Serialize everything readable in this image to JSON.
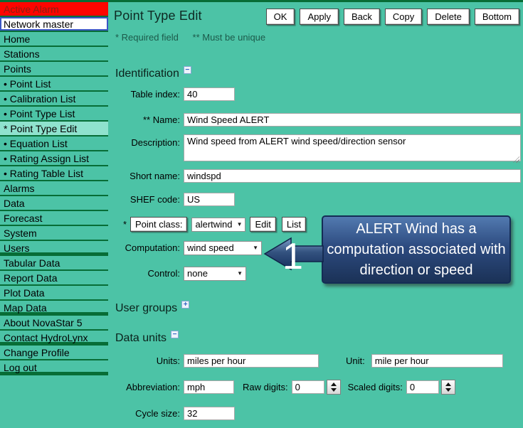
{
  "colors": {
    "background_teal": "#4cc3a6",
    "divider_green": "#076d36",
    "alarm_red": "#fe0500",
    "alarm_text": "#8b2012",
    "selected_item_bg": "#8fe2ce",
    "field_border_blue": "#3a56c4",
    "callout_navy_top": "#527ab0",
    "callout_navy_bottom": "#1b3257",
    "note_green": "#1c5a4a"
  },
  "sidebar": {
    "items": [
      {
        "label": "Active Alarm"
      },
      {
        "label": "Network master"
      },
      {
        "label": "Home"
      },
      {
        "label": "Stations"
      },
      {
        "label": "Points"
      },
      {
        "label": "• Point List"
      },
      {
        "label": "• Calibration List"
      },
      {
        "label": "• Point Type List"
      },
      {
        "label": " * Point Type Edit"
      },
      {
        "label": "• Equation List"
      },
      {
        "label": "• Rating Assign List"
      },
      {
        "label": "• Rating Table List"
      },
      {
        "label": "Alarms"
      },
      {
        "label": "Data"
      },
      {
        "label": "Forecast"
      },
      {
        "label": "System"
      },
      {
        "label": "Users"
      },
      {
        "label": "Tabular Data"
      },
      {
        "label": "Report Data"
      },
      {
        "label": "Plot Data"
      },
      {
        "label": "Map Data"
      },
      {
        "label": "About NovaStar 5"
      },
      {
        "label": "Contact HydroLynx"
      },
      {
        "label": "Change Profile"
      },
      {
        "label": "Log out"
      }
    ]
  },
  "page": {
    "title": "Point Type Edit",
    "required_note": "* Required field",
    "unique_note": "** Must be unique"
  },
  "toolbar": {
    "buttons": [
      "OK",
      "Apply",
      "Back",
      "Copy",
      "Delete",
      "Bottom"
    ]
  },
  "sections": {
    "identification": {
      "label": "Identification",
      "toggle": "−"
    },
    "user_groups": {
      "label": "User groups",
      "toggle": "+"
    },
    "data_units": {
      "label": "Data units",
      "toggle": "−"
    }
  },
  "form": {
    "table_index": {
      "label": "Table index:",
      "value": "40"
    },
    "name": {
      "label": "** Name:",
      "value": "Wind Speed ALERT"
    },
    "description": {
      "label": "Description:",
      "value": "Wind speed from ALERT wind speed/direction sensor"
    },
    "short_name": {
      "label": "Short name:",
      "value": "windspd"
    },
    "shef_code": {
      "label": "SHEF code:",
      "value": "US"
    },
    "point_class": {
      "required_mark": "*",
      "label": "Point class:",
      "value": "alertwind",
      "edit_label": "Edit",
      "list_label": "List"
    },
    "computation": {
      "label": "Computation:",
      "value": "wind speed"
    },
    "control": {
      "label": "Control:",
      "value": "none"
    },
    "units": {
      "label": "Units:",
      "value": "miles per hour"
    },
    "unit": {
      "label": "Unit:",
      "value": "mile per hour"
    },
    "abbreviation": {
      "label": "Abbreviation:",
      "value": "mph"
    },
    "raw_digits": {
      "label": "Raw digits:",
      "value": "0"
    },
    "scaled_digits": {
      "label": "Scaled digits:",
      "value": "0"
    },
    "cycle_size": {
      "label": "Cycle size:",
      "value": "32"
    }
  },
  "callout": {
    "step": "1",
    "text": "ALERT Wind has a computation associated with direction or speed"
  },
  "dropdown_caret": "▼"
}
